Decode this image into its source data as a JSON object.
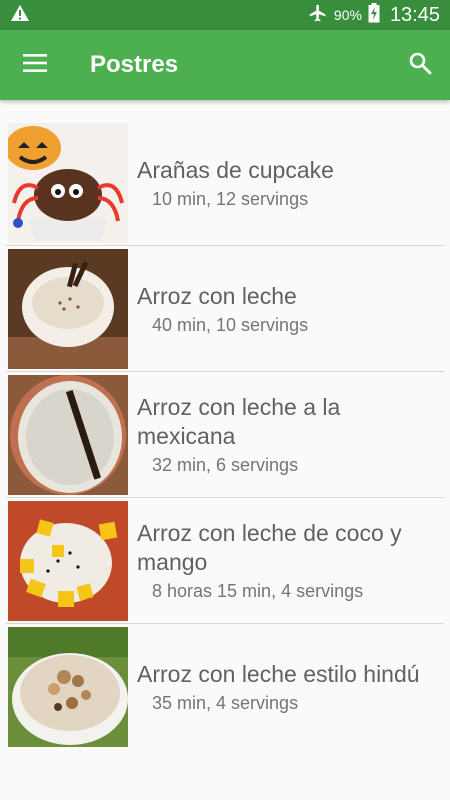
{
  "status_bar": {
    "battery_percent": "90%",
    "time": "13:45",
    "icons": [
      "warning-icon",
      "airplane-icon",
      "battery-charging-icon"
    ]
  },
  "app_bar": {
    "title": "Postres",
    "icons": [
      "menu-icon",
      "search-icon"
    ]
  },
  "recipes": [
    {
      "title": "Arañas de cupcake",
      "meta": "10 min, 12 servings"
    },
    {
      "title": "Arroz con leche",
      "meta": "40 min, 10 servings"
    },
    {
      "title": "Arroz con leche a la mexicana",
      "meta": "32 min, 6 servings"
    },
    {
      "title": "Arroz con leche de coco y mango",
      "meta": "8 horas 15 min, 4 servings"
    },
    {
      "title": "Arroz con leche estilo hindú",
      "meta": "35 min, 4 servings"
    }
  ],
  "colors": {
    "primary": "#4caf50",
    "primary_dark": "#388e3c",
    "text_primary": "#616161",
    "text_secondary": "#757575",
    "background": "#fafafa"
  }
}
